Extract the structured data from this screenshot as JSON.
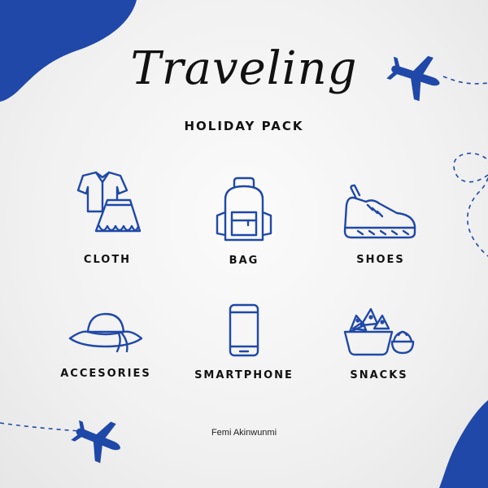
{
  "title": "Traveling",
  "subtitle": "HOLIDAY PACK",
  "items": [
    {
      "label": "CLOTH",
      "icon": "clothes-icon"
    },
    {
      "label": "BAG",
      "icon": "backpack-icon"
    },
    {
      "label": "SHOES",
      "icon": "sneaker-icon"
    },
    {
      "label": "ACCESORIES",
      "icon": "hat-icon"
    },
    {
      "label": "SMARTPHONE",
      "icon": "smartphone-icon"
    },
    {
      "label": "SNACKS",
      "icon": "snacks-icon"
    }
  ],
  "author": "Femi Akinwunmi",
  "colors": {
    "accent": "#1f48a8",
    "icon_stroke": "#1f48a8",
    "text": "#111111"
  }
}
